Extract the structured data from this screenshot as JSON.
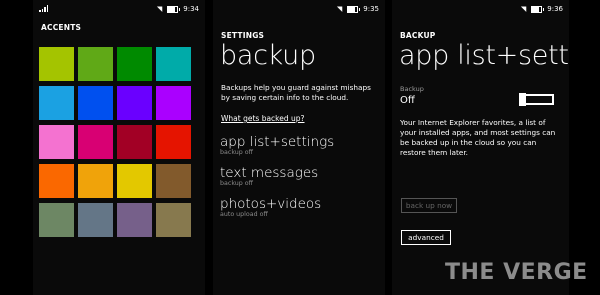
{
  "phone1": {
    "status_time": "9:34",
    "title": "ACCENTS",
    "tiles": [
      {
        "name": "lime",
        "color": "#a4c400"
      },
      {
        "name": "green",
        "color": "#60a917"
      },
      {
        "name": "emerald",
        "color": "#008a00"
      },
      {
        "name": "teal",
        "color": "#00aba9"
      },
      {
        "name": "cyan",
        "color": "#1ba1e2"
      },
      {
        "name": "cobalt",
        "color": "#0050ef"
      },
      {
        "name": "indigo",
        "color": "#6a00ff"
      },
      {
        "name": "violet",
        "color": "#aa00ff"
      },
      {
        "name": "pink",
        "color": "#f472d0"
      },
      {
        "name": "magenta",
        "color": "#d80073"
      },
      {
        "name": "crimson",
        "color": "#a20025"
      },
      {
        "name": "red",
        "color": "#e51400"
      },
      {
        "name": "orange",
        "color": "#fa6800"
      },
      {
        "name": "amber",
        "color": "#f0a30a"
      },
      {
        "name": "yellow",
        "color": "#e3c800"
      },
      {
        "name": "brown",
        "color": "#825a2c"
      },
      {
        "name": "olive",
        "color": "#6d8764"
      },
      {
        "name": "steel",
        "color": "#647687"
      },
      {
        "name": "mauve",
        "color": "#76608a"
      },
      {
        "name": "taupe",
        "color": "#87794e"
      }
    ]
  },
  "phone2": {
    "status_time": "9:35",
    "subtitle": "SETTINGS",
    "title": "backup",
    "description": "Backups help you guard against mishaps by saving certain info to the cloud.",
    "link": "What gets backed up?",
    "items": [
      {
        "name": "app list+settings",
        "status": "backup off"
      },
      {
        "name": "text messages",
        "status": "backup off"
      },
      {
        "name": "photos+videos",
        "status": "auto upload off"
      }
    ]
  },
  "phone3": {
    "status_time": "9:36",
    "subtitle": "BACKUP",
    "title": "app list+settings",
    "toggle_label": "Backup",
    "toggle_state": "Off",
    "description": "Your Internet Explorer favorites, a list of your installed apps, and most settings can be backed up in the cloud so you can restore them later.",
    "backup_now": "back up now",
    "advanced": "advanced"
  },
  "watermark": "THE VERGE"
}
